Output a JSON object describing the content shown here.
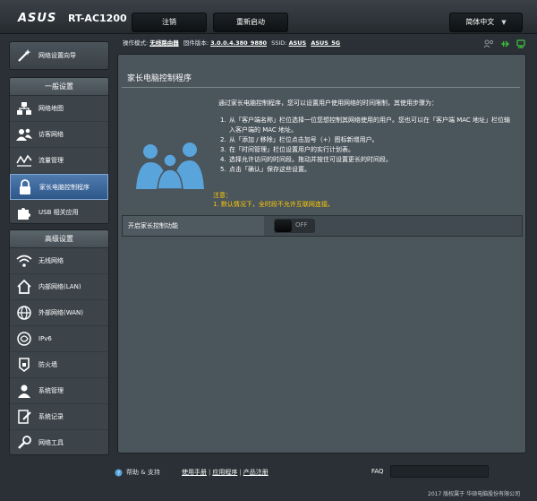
{
  "header": {
    "logo": "ASUS",
    "model": "RT-AC1200",
    "logout_label": "注销",
    "reboot_label": "重新启动",
    "language": "简体中文",
    "language_caret": "▼"
  },
  "info_bar": {
    "mode_label": "操作模式:",
    "mode_value": "无线路由器",
    "firmware_label": "固件版本:",
    "firmware_value": "3.0.0.4.380_9880",
    "ssid_label": "SSID:",
    "ssid_values": [
      "ASUS",
      "ASUS_5G"
    ]
  },
  "sidebar": {
    "wizard_label": "网络设置向导",
    "general_title": "一般设置",
    "general_items": [
      {
        "label": "网络地图",
        "icon": "network-map-icon"
      },
      {
        "label": "访客网络",
        "icon": "guest-network-icon"
      },
      {
        "label": "流量管理",
        "icon": "traffic-manager-icon"
      },
      {
        "label": "家长电脑控制程序",
        "icon": "lock-icon",
        "active": true
      },
      {
        "label": "USB 相关应用",
        "icon": "puzzle-icon"
      }
    ],
    "advanced_title": "高级设置",
    "advanced_items": [
      {
        "label": "无线网络",
        "icon": "wireless-icon"
      },
      {
        "label": "内部网络(LAN)",
        "icon": "home-icon"
      },
      {
        "label": "外部网络(WAN)",
        "icon": "globe-icon"
      },
      {
        "label": "IPv6",
        "icon": "ipv6-icon"
      },
      {
        "label": "防火墙",
        "icon": "firewall-icon"
      },
      {
        "label": "系统管理",
        "icon": "admin-icon"
      },
      {
        "label": "系统记录",
        "icon": "log-icon"
      },
      {
        "label": "网络工具",
        "icon": "tools-icon"
      }
    ]
  },
  "main": {
    "title": "家长电脑控制程序",
    "intro": "通过家长电脑控制程序，您可以设置用户使用网络的时间限制，其使用步骤为：",
    "steps": [
      {
        "num": "1.",
        "text": "从「客户端名称」栏位选择一位您想控制其网络使用的用户。您也可以在「客户端 MAC 地址」栏位输入客户端的 MAC 地址。"
      },
      {
        "num": "2.",
        "text": "从「添加 / 移除」栏位点击加号（+）图标新增用户。"
      },
      {
        "num": "3.",
        "text": "在「时间管理」栏位设置用户的实行计划表。"
      },
      {
        "num": "4.",
        "text": "选择允许访问的时间段。拖动并按住可设置更长的时间段。"
      },
      {
        "num": "5.",
        "text": "点击「确认」保存这些设置。"
      }
    ],
    "note_title": "注意：",
    "note_text": "1. 默认情况下，全时段不允许互联网连接。",
    "toggle_label": "开启家长控制功能",
    "toggle_state": "OFF"
  },
  "footer": {
    "help_label": "帮助 & 支持",
    "links": [
      "使用手册",
      "应用程序",
      "产品注册"
    ],
    "faq_label": "FAQ",
    "copyright": "2017 版权属于 华硕电脑股份有限公司"
  },
  "colors": {
    "accent_active": "#3a6aa3",
    "note_yellow": "#ffcc00",
    "background": "#2a3035"
  }
}
